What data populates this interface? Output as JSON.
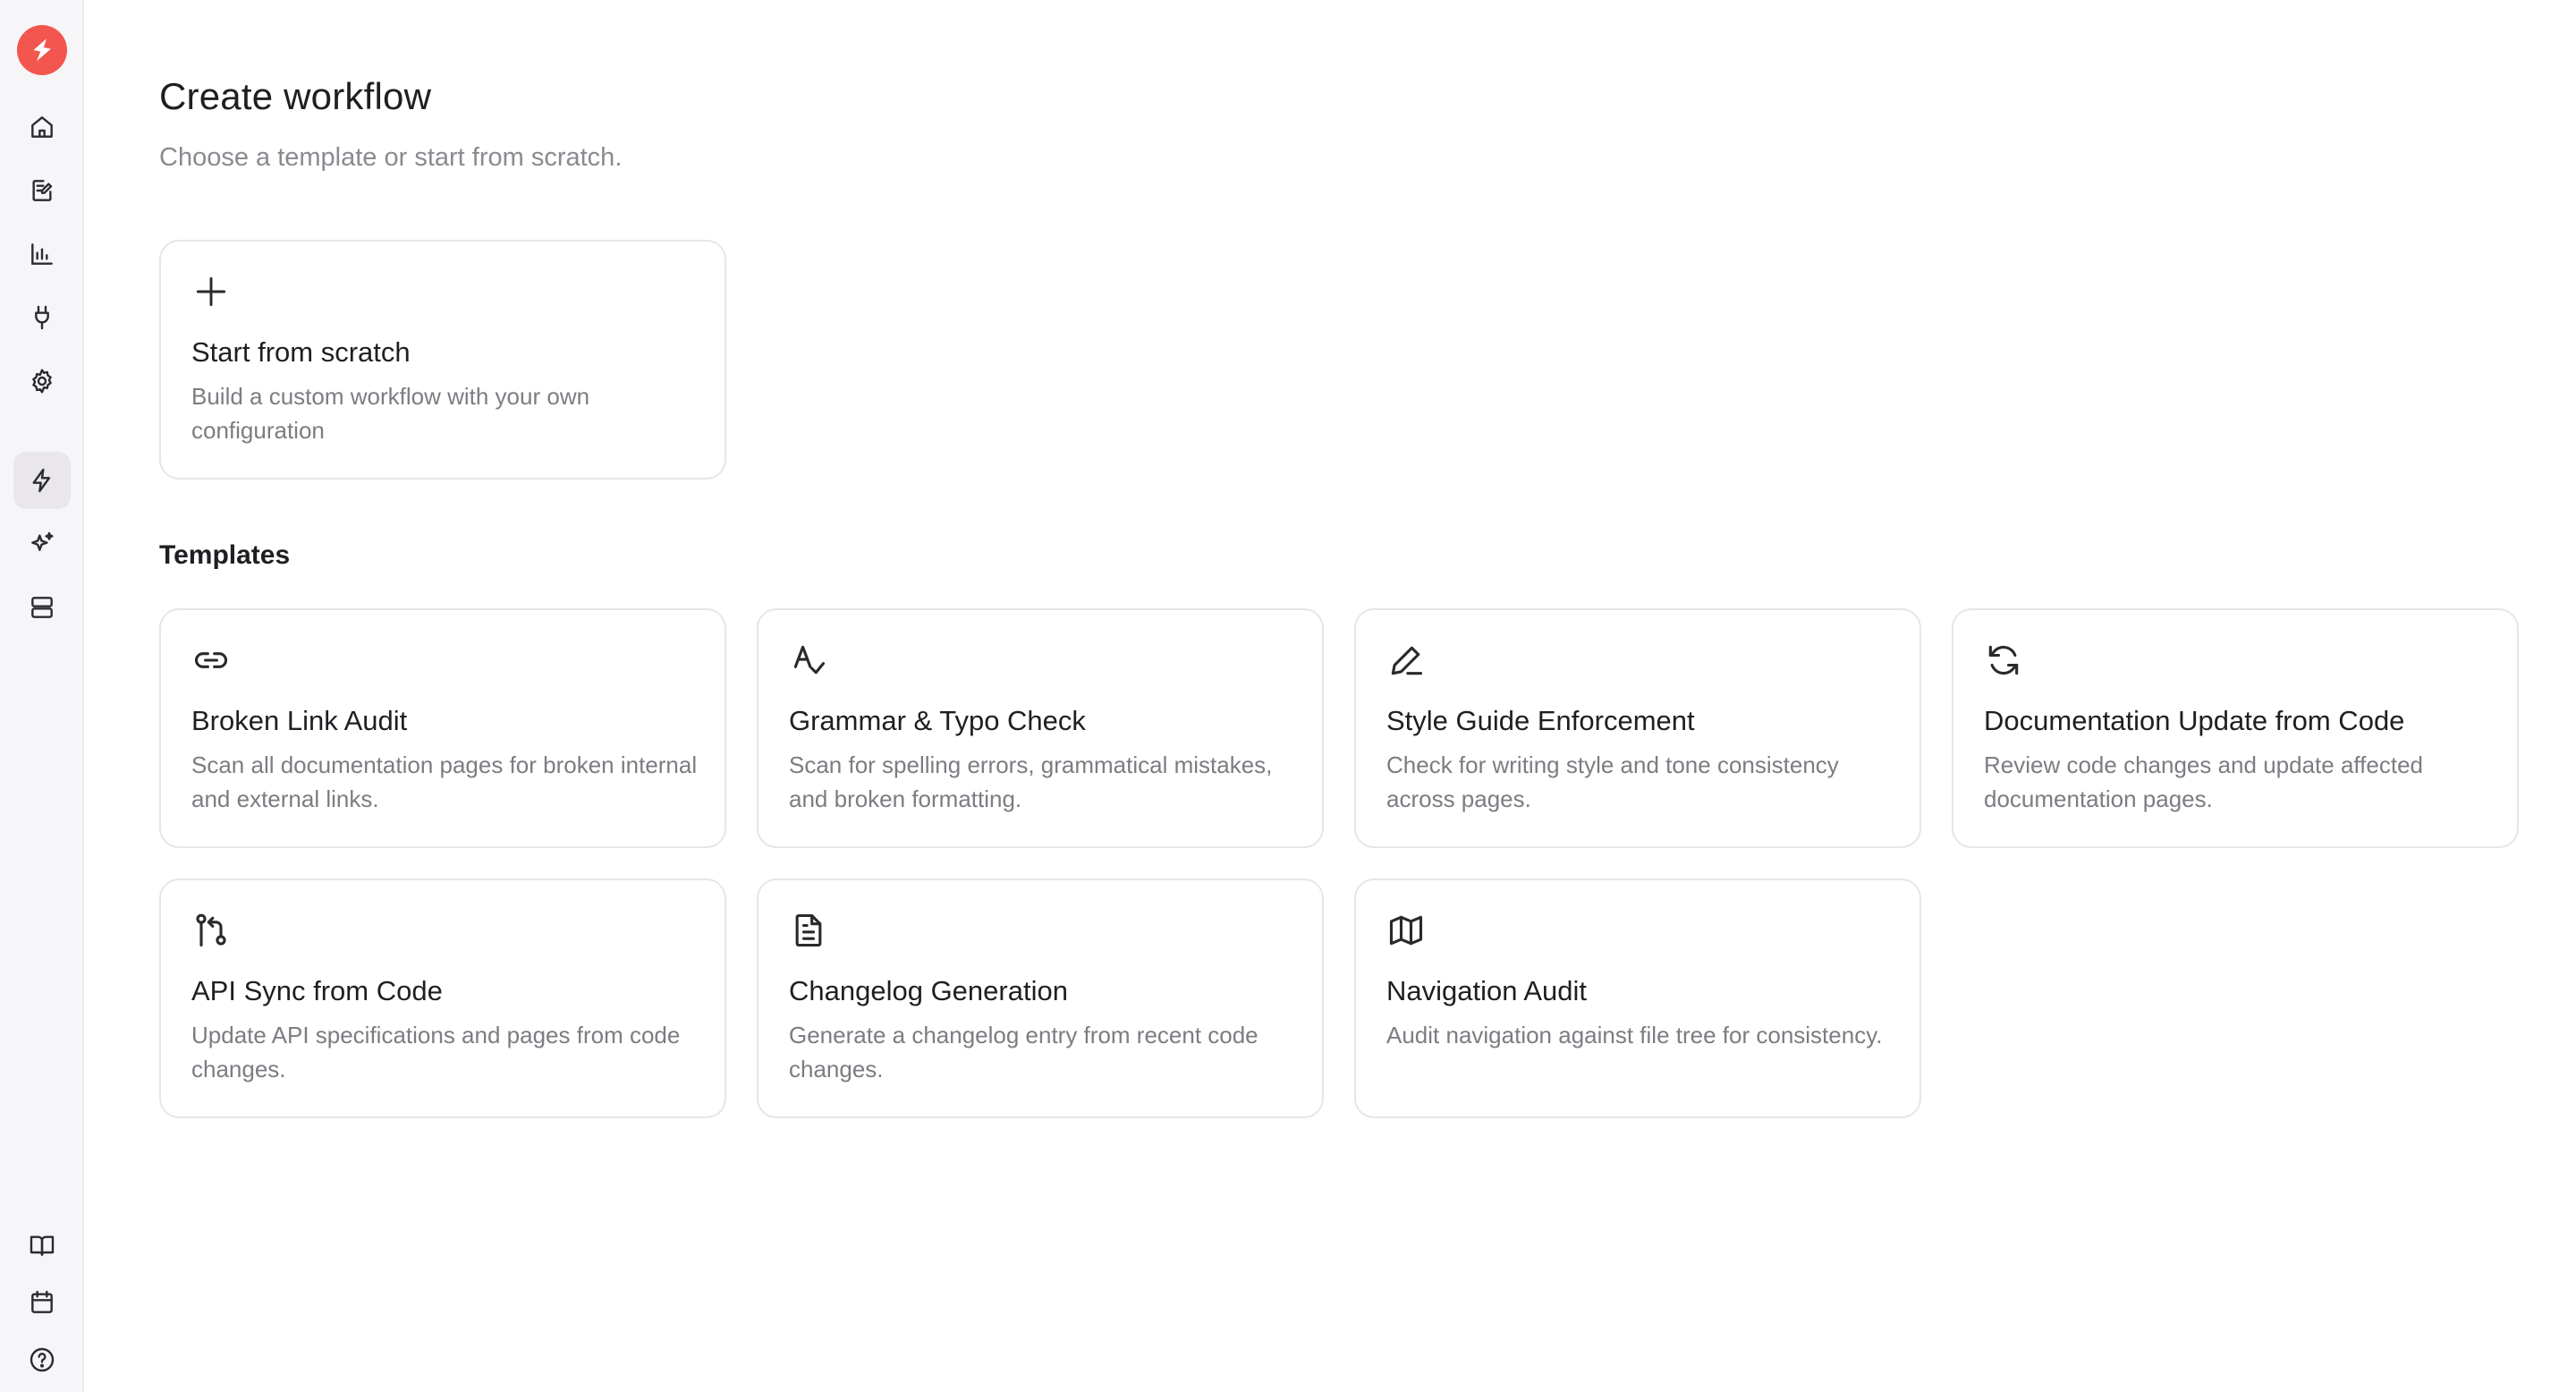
{
  "sidebar": {
    "logo": {
      "icon": "bolt-icon",
      "color": "#f2564f"
    },
    "nav": [
      {
        "id": "home",
        "icon": "home-icon"
      },
      {
        "id": "editor",
        "icon": "edit-document-icon"
      },
      {
        "id": "analytics",
        "icon": "bar-chart-icon"
      },
      {
        "id": "integrations",
        "icon": "plug-icon"
      },
      {
        "id": "settings",
        "icon": "gear-icon"
      },
      {
        "id": "workflows",
        "icon": "bolt-icon",
        "active": true
      },
      {
        "id": "ai",
        "icon": "sparkles-icon"
      },
      {
        "id": "storage",
        "icon": "server-icon"
      }
    ],
    "bottom_nav": [
      {
        "id": "docs",
        "icon": "book-icon"
      },
      {
        "id": "calendar",
        "icon": "calendar-icon"
      },
      {
        "id": "help",
        "icon": "help-circle-icon"
      }
    ]
  },
  "header": {
    "title": "Create workflow",
    "subtitle": "Choose a template or start from scratch."
  },
  "scratch_card": {
    "icon": "plus-icon",
    "title": "Start from scratch",
    "description": "Build a custom workflow with your own configuration"
  },
  "templates": {
    "heading": "Templates",
    "items": [
      {
        "icon": "link-icon",
        "title": "Broken Link Audit",
        "description": "Scan all documentation pages for broken internal and external links."
      },
      {
        "icon": "spell-check-icon",
        "title": "Grammar & Typo Check",
        "description": "Scan for spelling errors, grammatical mistakes, and broken formatting."
      },
      {
        "icon": "pen-icon",
        "title": "Style Guide Enforcement",
        "description": "Check for writing style and tone consistency across pages."
      },
      {
        "icon": "refresh-icon",
        "title": "Documentation Update from Code",
        "description": "Review code changes and update affected documentation pages."
      },
      {
        "icon": "git-pull-request-icon",
        "title": "API Sync from Code",
        "description": "Update API specifications and pages from code changes."
      },
      {
        "icon": "file-text-icon",
        "title": "Changelog Generation",
        "description": "Generate a changelog entry from recent code changes."
      },
      {
        "icon": "map-icon",
        "title": "Navigation Audit",
        "description": "Audit navigation against file tree for consistency."
      }
    ]
  }
}
